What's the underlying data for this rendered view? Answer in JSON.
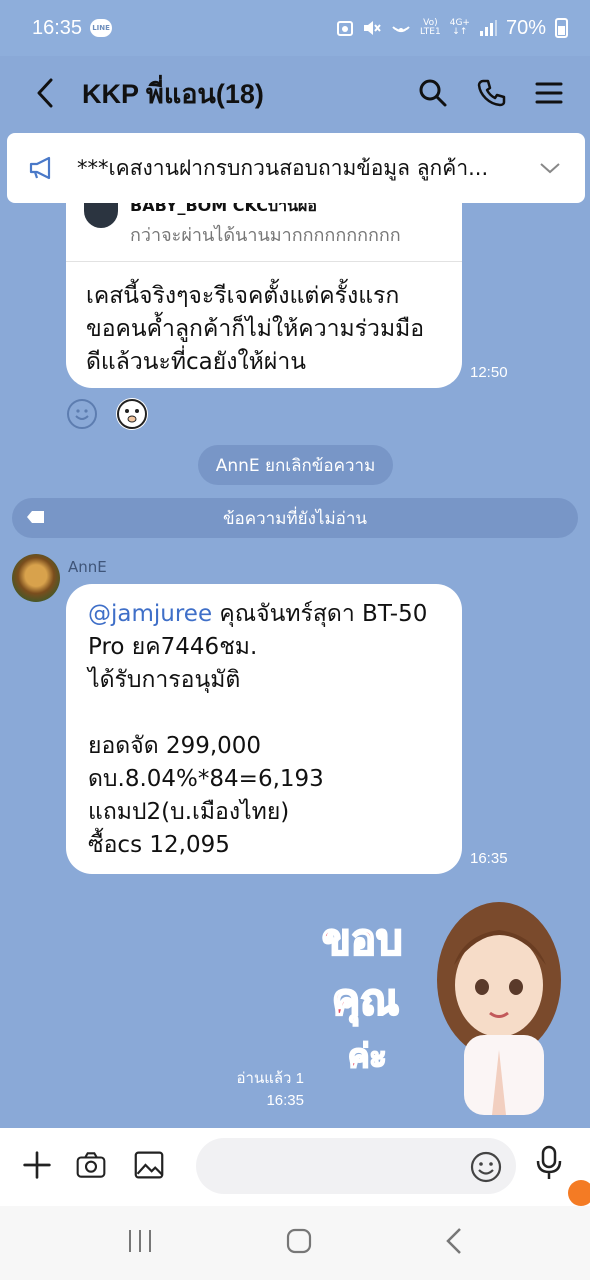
{
  "status_bar": {
    "time": "16:35",
    "app_badge": "LINE",
    "network_top": "Vo)",
    "network_bottom": "LTE1",
    "gen_label": "4G+",
    "battery": "70%"
  },
  "header": {
    "title": "KKP พี่แอน(18)"
  },
  "announcement": {
    "text": "***เคสงานฝากรบกวนสอบถามข้อมูล ลูกค้า..."
  },
  "quoted_reply": {
    "name": "BABY_BOM CKCบ้านผือ",
    "text": "กว่าจะผ่านได้นานมากกกกกกกกกก"
  },
  "message1": {
    "lines": [
      "เคสนี้จริงๆจะรีเจคตั้งแต่ครั้งแรก",
      "ขอคนค้ำลูกค้าก็ไม่ให้ความร่วมมือ",
      "ดีแล้วนะที่caยังให้ผ่าน"
    ],
    "time": "12:50"
  },
  "system": {
    "unsent": "AnnE ยกเลิกข้อความ",
    "unread_divider": "ข้อความที่ยังไม่อ่าน"
  },
  "message2": {
    "sender": "AnnE",
    "mention": "@jamjuree",
    "first_line_rest": " คุณจันทร์สุดา BT-50",
    "lines": [
      "Pro ยค7446ชม.",
      "ได้รับการอนุมัติ",
      "",
      "ยอดจัด 299,000",
      "ดบ.8.04%*84=6,193",
      "แถมป2(บ.เมืองไทย)",
      "ซื้อcs 12,095"
    ],
    "time": "16:35"
  },
  "sticker": {
    "line1": "ขอบ",
    "line2": "คุณ",
    "line3": "ค่ะ"
  },
  "sent_status": {
    "read": "อ่านแล้ว 1",
    "time": "16:35"
  },
  "colors": {
    "chat_bg": "#8aa9d7",
    "mention": "#3f6fc8",
    "sticker_text": "#e8485f"
  }
}
